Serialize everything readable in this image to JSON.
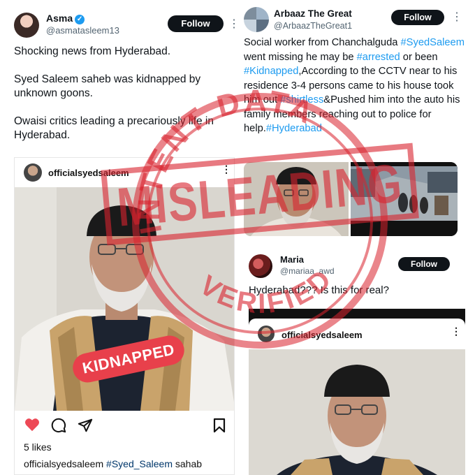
{
  "left_tweet": {
    "author_name": "Asma",
    "verified_icon": "verified-badge-icon",
    "handle": "@asmatasleem13",
    "follow_label": "Follow",
    "paragraphs": [
      "Shocking news from Hyderabad.",
      "Syed Saleem saheb was kidnapped by unknown goons.",
      "Owaisi critics leading a precariously life in Hyderabad."
    ],
    "embed": {
      "account": "officialsyedsaleem",
      "sticker": "KIDNAPPED",
      "likes": "5 likes",
      "caption_user": "officialsyedsaleem",
      "caption_tag": "#Syed_Saleem",
      "caption_rest": " sahab"
    }
  },
  "right_tweet": {
    "author_name": "Arbaaz The Great",
    "handle": "@ArbaazTheGreat1",
    "follow_label": "Follow",
    "text_parts": [
      "Social worker from Chanchalguda ",
      "#SyedSaleem",
      " went missing he may be ",
      "#arrested",
      " or been ",
      "#Kidnapped",
      ",According to the CCTV near to his residence 3-4 persons came to his house took him out ",
      "#shirtless",
      "&Pushed him into the auto his family members reaching out to police for help.",
      "#Hyderabad"
    ]
  },
  "bottom_tweet": {
    "author_name": "Maria",
    "handle": "@mariaa_awd",
    "follow_label": "Follow",
    "text": "Hyderabad??? Is this for real?",
    "embed": {
      "account": "officialsyedsaleem"
    }
  },
  "stamp": {
    "top_text": "INTENT DATA",
    "main_text": "MISLEADING",
    "bottom_text": "VERIFIED",
    "color": "#d9232e"
  },
  "colors": {
    "link": "#1d9bf0",
    "follow_bg": "#0f1419",
    "like": "#ed4956"
  }
}
